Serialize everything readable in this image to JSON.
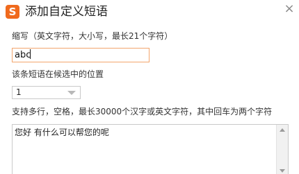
{
  "dialog": {
    "logo_glyph": "S",
    "title": "添加自定义短语",
    "close_glyph": "×",
    "accent_color": "#f06a1d"
  },
  "abbreviation": {
    "label": "缩写（英文字符，大小写，最长21个字符）",
    "value": "abc"
  },
  "position": {
    "label": "该条短语在候选中的位置",
    "selected": "1"
  },
  "phrase": {
    "label": "支持多行，空格，最长30000个汉字或英文字符，其中回车为两个字符",
    "value": "您好 有什么可以帮您的呢"
  }
}
